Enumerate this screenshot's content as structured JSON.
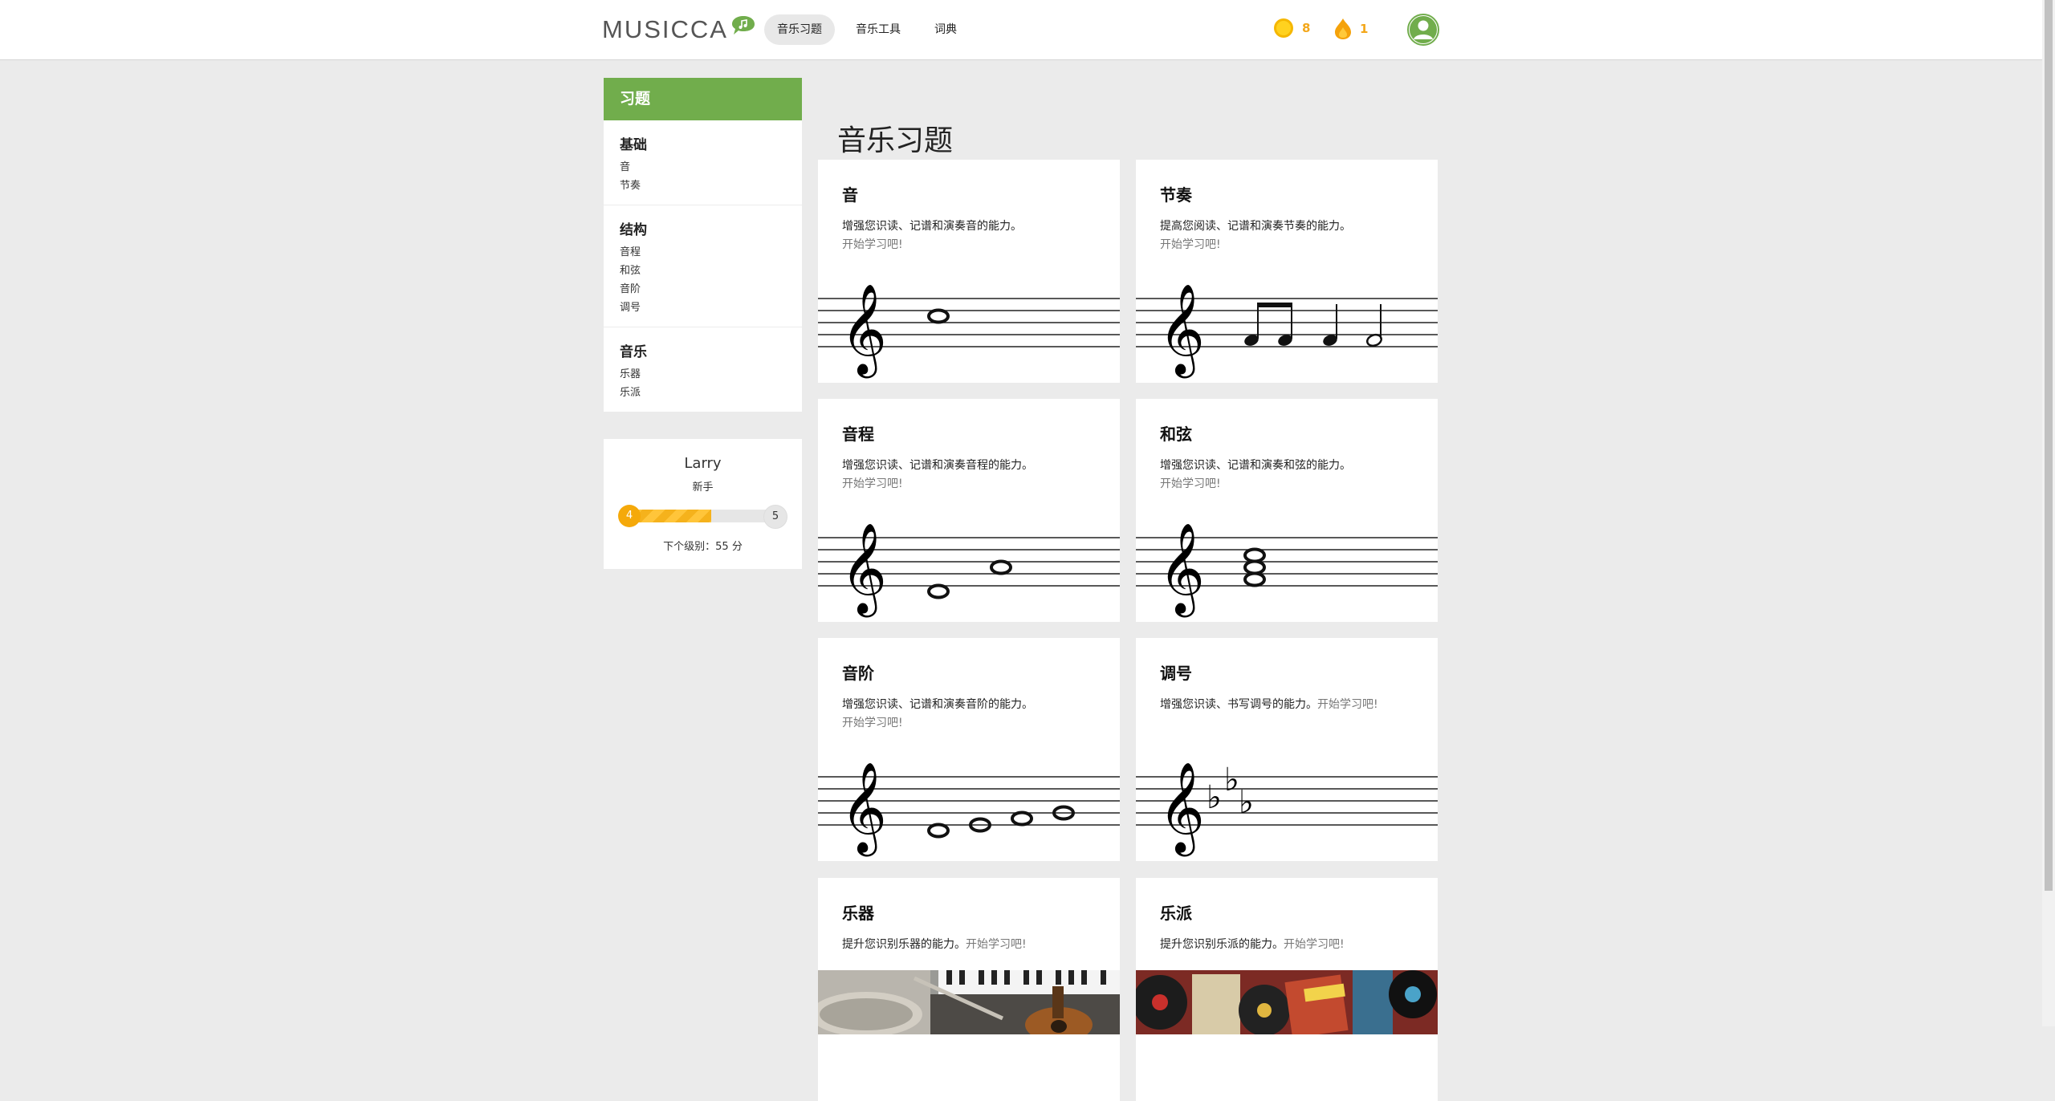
{
  "header": {
    "logo_text": "MUSICCA",
    "nav": [
      {
        "label": "音乐习题",
        "active": true
      },
      {
        "label": "音乐工具",
        "active": false
      },
      {
        "label": "词典",
        "active": false
      }
    ],
    "coins": "8",
    "streak": "1"
  },
  "sidebar": {
    "heading": "习题",
    "groups": [
      {
        "title": "基础",
        "links": [
          "音",
          "节奏"
        ]
      },
      {
        "title": "结构",
        "links": [
          "音程",
          "和弦",
          "音阶",
          "调号"
        ]
      },
      {
        "title": "音乐",
        "links": [
          "乐器",
          "乐派"
        ]
      }
    ]
  },
  "profile": {
    "name": "Larry",
    "rank": "新手",
    "level_current": "4",
    "level_next": "5",
    "progress": 0.55,
    "next_level_text": "下个级别：55 分"
  },
  "main": {
    "title": "音乐习题",
    "cards": [
      {
        "title": "音",
        "desc": "增强您识读、记谱和演奏音的能力。",
        "cta": "开始学习吧!"
      },
      {
        "title": "节奏",
        "desc": "提高您阅读、记谱和演奏节奏的能力。",
        "cta": "开始学习吧!"
      },
      {
        "title": "音程",
        "desc": "增强您识读、记谱和演奏音程的能力。",
        "cta": "开始学习吧!"
      },
      {
        "title": "和弦",
        "desc": "增强您识读、记谱和演奏和弦的能力。",
        "cta": "开始学习吧!"
      },
      {
        "title": "音阶",
        "desc": "增强您识读、记谱和演奏音阶的能力。",
        "cta": "开始学习吧!"
      },
      {
        "title": "调号",
        "desc": "增强您识读、书写调号的能力。",
        "cta": "开始学习吧!"
      },
      {
        "title": "乐器",
        "desc": "提升您识别乐器的能力。",
        "cta": "开始学习吧!"
      },
      {
        "title": "乐派",
        "desc": "提升您识别乐派的能力。",
        "cta": "开始学习吧!"
      }
    ]
  },
  "colors": {
    "accent_green": "#71ad4c",
    "coin_gold": "#f5a90a",
    "background": "#ebebeb"
  },
  "icons": [
    "music-bubble-icon",
    "coin-icon",
    "flame-icon",
    "user-avatar-icon",
    "treble-clef-icon"
  ]
}
